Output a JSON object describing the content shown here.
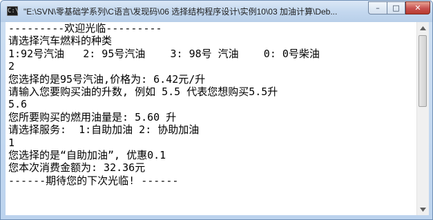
{
  "window": {
    "title": "\"E:\\SVN\\零基础学系列\\C语言\\发现码\\06 选择结构程序设计\\实例10\\03 加油计算\\Deb...",
    "icon_text": "C:\\",
    "buttons": {
      "minimize": "–",
      "maximize": "□",
      "close": "✕"
    }
  },
  "console": {
    "lines": [
      "---------欢迎光临---------",
      "请选择汽车燃料的种类",
      "1:92号汽油   2: 95号汽油    3: 98号 汽油    0: 0号柴油",
      "2",
      "您选择的是95号汽油,价格为: 6.42元/升",
      "请输入您要购买油的升数, 例如 5.5 代表您想购买5.5升",
      "5.6",
      "您所要购买的燃用油量是: 5.60 升",
      "请选择服务:  1:自助加油 2: 协助加油",
      "1",
      "您选择的是“自助加油”, 优惠0.1",
      "您本次消费金额为: 32.36元",
      "------期待您的下次光临! ------"
    ]
  },
  "scrollbar": {
    "up_icon": "scroll-up-arrow",
    "down_icon": "scroll-down-arrow"
  }
}
